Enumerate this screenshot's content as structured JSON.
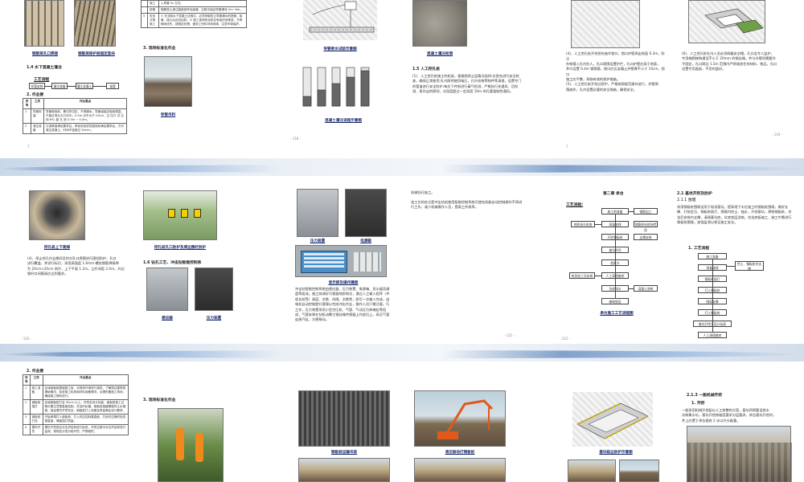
{
  "p1": {
    "captions": [
      "钢筋笼孔口焊接",
      "钢筋笼保护层固定垫块"
    ],
    "section_1_4": "1.4  水下混凝土灌注",
    "flow_title": "工艺流程",
    "flow_boxes": [
      "导管安装",
      "灌注准备",
      "灌注混凝土",
      "拔管"
    ],
    "section_2": "2.  作业要",
    "table_headers": [
      "序号",
      "工序",
      "作业要点"
    ],
    "table_rows": [
      [
        "1",
        "导管安装",
        "导管使用前，需试拼试压，不得漏水。导管组装应轴线顺直，不能过弯从孔口对中；0.5m 对不大于 10cm，过 压力 试  达到 6%; 距 孔 底 0.3m ~ 0.5m。"
      ],
      [
        "2",
        "灌注准备",
        "沉渣厚度满足要求后，再检测泥浆性能指标满足要求后，方可灌注混凝土，时间不宜超过 30min。"
      ]
    ],
    "page_number": "- 117 -",
    "foot_mark": "7"
  },
  "p2": {
    "table_rows": [
      [
        "",
        "施工",
        "入导管 5s 左右。"
      ],
      [
        "",
        "拔管",
        "随着混土灌注高度部件伪装管，过程中保证导管埋深 2m~6m。"
      ],
      [
        "5",
        "安全文明施工",
        "① 在浇筑水下混凝土过程中，必须采取防止导管漏水的措施，接管、接孔后应包括防。② 施工现场的泥浆应有组织地堆放，不得随地流失，按规定处理，做到工完料尽场地清，注意环境保护。"
      ]
    ],
    "section_3": "3.  现场标准化作业",
    "caption": "导管吊料",
    "page_number": "- 118 -"
  },
  "p3": {
    "caption_top": "导管密水试验示意图",
    "caption_right": "混凝土灌注检测",
    "caption_bottom": "混凝土灌注流程示意图",
    "section_1_5": "1.5  人工挖孔桩",
    "para": "(1)、人工挖孔桩施工的机具，根据地质土层情况选择;应首先进行安全检查，确保正常使用;孔内照明使用电压，孔内衣物等物件等清理，设置专门的管道进行安全防护;每次下井前进行毒气检测，严格执行先通风、后检测、再作业的原则，对深度超过一定深度 10m 的孔要强制性通风。",
    "page_number": "- 118 -"
  },
  "p4": {
    "para_lines": [
      "(4)、人工挖孔桩开挖前先施作锁口，锁口护壁高出地面 0.3m，防止",
      "杂物落入孔内伤人，孔口周围设置护栏，孔口护壁应高于地面，",
      "井口设置 0.4m 钢筋箍，锁口应比混凝土护壁厚不小于 10cm，锁口",
      "施工应平整，采取有效的保护措施。",
      "(5)、人工挖孔桩开挖过程中，严格按照规范操作进行，护壁周",
      "围施作，孔内设置必要的安全措施，确保安全。"
    ],
    "right_lines": [
      "(6)、人工挖孔桩孔内人员必须佩戴安全帽，孔口设专人监护，",
      "专用梯爬梯和通话不小于 20mm 的钢丝绳，井与外壁间需要作",
      "平固定，孔口周边 1.5m 范围内严禁堆放任何材料、物品，孔口",
      "设置专用盖板，不用时盖好。"
    ],
    "page_number": "- 119 -",
    "foot_mark": "7"
  },
  "p5": {
    "caption_left": "挖孔桩上下爬梯",
    "caption_right": "挖孔桩孔口防护及周边围栏防护",
    "para_lines": [
      "(4)、停止挖孔作业期间及时对孔口周围进行围挡防护，孔口",
      "进行覆盖，并进行标识，采用高强度 1.6mm 螺纹钢筋焊接焊",
      "为 20cm×20cm 网片，上下平面 1.2m，立杆间距 2.0m，外边",
      "钢杆口间围高应达到要求。"
    ],
    "section_1_6": "1.6  钻孔工艺、冲击钻智能控制系",
    "caption_pump": "感应器",
    "caption_panel": "压力装置",
    "page_number": "- 120 -",
    "foot_mark": "7"
  },
  "p6": {
    "caption_a": "压力装置",
    "caption_b": "电源箱",
    "caption_c": "显示屏及操作键盘",
    "top_text": "机械钻孔施工。",
    "top_para": "该工艺的优点是冲击钻机使用智能控制系统可使钻机能自动控制操作不停进行工作，减少机械操作人员，提高工作效率。",
    "para": "冲击钻智能控制系统由感应器、压力装置、电源箱、显示器及键盘等组成。施工前调好可根据地质地况，通过人工输入程序（冲程长短等）高度、次数、间隔、次数等，即可一次输入完成，由电机自动控制提升落锤以完成冲击作业，操作人员只需注意。行工作，压力装置采用小型空压机、气管、气动压力伸缩缸等组成，气管安装在钻机动臂主钢丝绳传感器上作部位上，高压气管连接汽缸，方便移动。",
    "page_number": "- 121 -",
    "foot_mark": "7"
  },
  "p7": {
    "chapter": "第二章   承台",
    "flow_label": "工艺流程:",
    "flow_boxes": [
      "施工前准备",
      "测量放线",
      "地质选孔桩查",
      "开挖钢板桩",
      "基坑开挖",
      "凿桩头",
      "人工清理基底",
      "坑底排水",
      "基础垫层",
      "桩身加工及安装",
      "模板施工",
      "检查验收",
      "拆模、养护",
      "混凝土浇筑",
      "测温",
      "承台施工后外护",
      "钢筋加工",
      "钢筋原材进场检验",
      "支撑安装"
    ],
    "caption": "承台施工工艺流程图",
    "page_number": "- 122 -",
    "foot_mark": "7"
  },
  "p8": {
    "section_2_1": "2.1  基坑开挖及防护",
    "sub_1": "2.1.1  围堰",
    "para": "采用钢板桩围堰适用于较深基坑，提高地下水位施工时钢板桩围堰，做好支撑、打桩定位、钢板桩插打、围堰内挖土、抽水、开挖基坑，焊接钢板桩，合龙后安装内支撑，清理基坑底，坑底垫层浇筑，合龙底板施工、施工中需进行钢板桩围堰，加强监测以保证施工安全。",
    "sub_2": "1. 工艺流程",
    "flow_boxes": [
      "施工准备",
      "测量放线",
      "钢板桩插打",
      "挖土、钢板桩内支撑",
      "基坑开挖至设计标高",
      "打入钢板桩",
      "围檩支撑",
      "打入钢板桩",
      "混凝土灌注",
      "人工清理基底"
    ],
    "page_number": ""
  },
  "p9": {
    "section_2": "2.  作业要",
    "table_headers": [
      "序号",
      "工序",
      "作业要点"
    ],
    "table_rows": [
      [
        "1",
        "施工准备",
        "区域钢板桩围堰施工前，对现场环境进行调查，了解周边建筑物基础情况，检查施工机具和材料准备情况，合理布置施工场地，确保施工顺利进行。"
      ],
      [
        "2",
        "钢板桩插打",
        "区域钢板桩打至 30cm 以上、开挖至设计标高，钢板桩施工过程中要注意垂直度控制，并及时纠偏，钢板桩接缝需做好止水措施，保证基坑开挖安全，钢板桩打入深度及质量满足设计要求。"
      ],
      [
        "3",
        "钢板桩打设",
        "开始单根打入钢板桩，打入时应控制垂直度，打设时应随时检查垂直度，确保插打质量。"
      ],
      [
        "4",
        "基坑开挖",
        "基坑开挖前应对支护结构进行检查，开挖过程中对支护结构进行监测，按规定分层分段开挖，严禁超挖。"
      ]
    ],
    "section_3": "3.  现场标准化作业"
  },
  "p10": {
    "caption_left": "钢板桩运输吊装",
    "caption_right": "液压振动打钢板桩"
  },
  "p11": {
    "caption_top": "基坑临边防护示意图",
    "section_2_1_3": "2.1.3  一般机械开挖",
    "sub": "1.  开挖",
    "para_lines": [
      "一般采用机械开挖配以人工修整的方案，基坑四周要设排水",
      "沟和集水坑，基坑开挖按坡度要求分层要求，承台基坑开挖时，",
      "井上应置于承台基底 2 米以外分级重。"
    ]
  }
}
